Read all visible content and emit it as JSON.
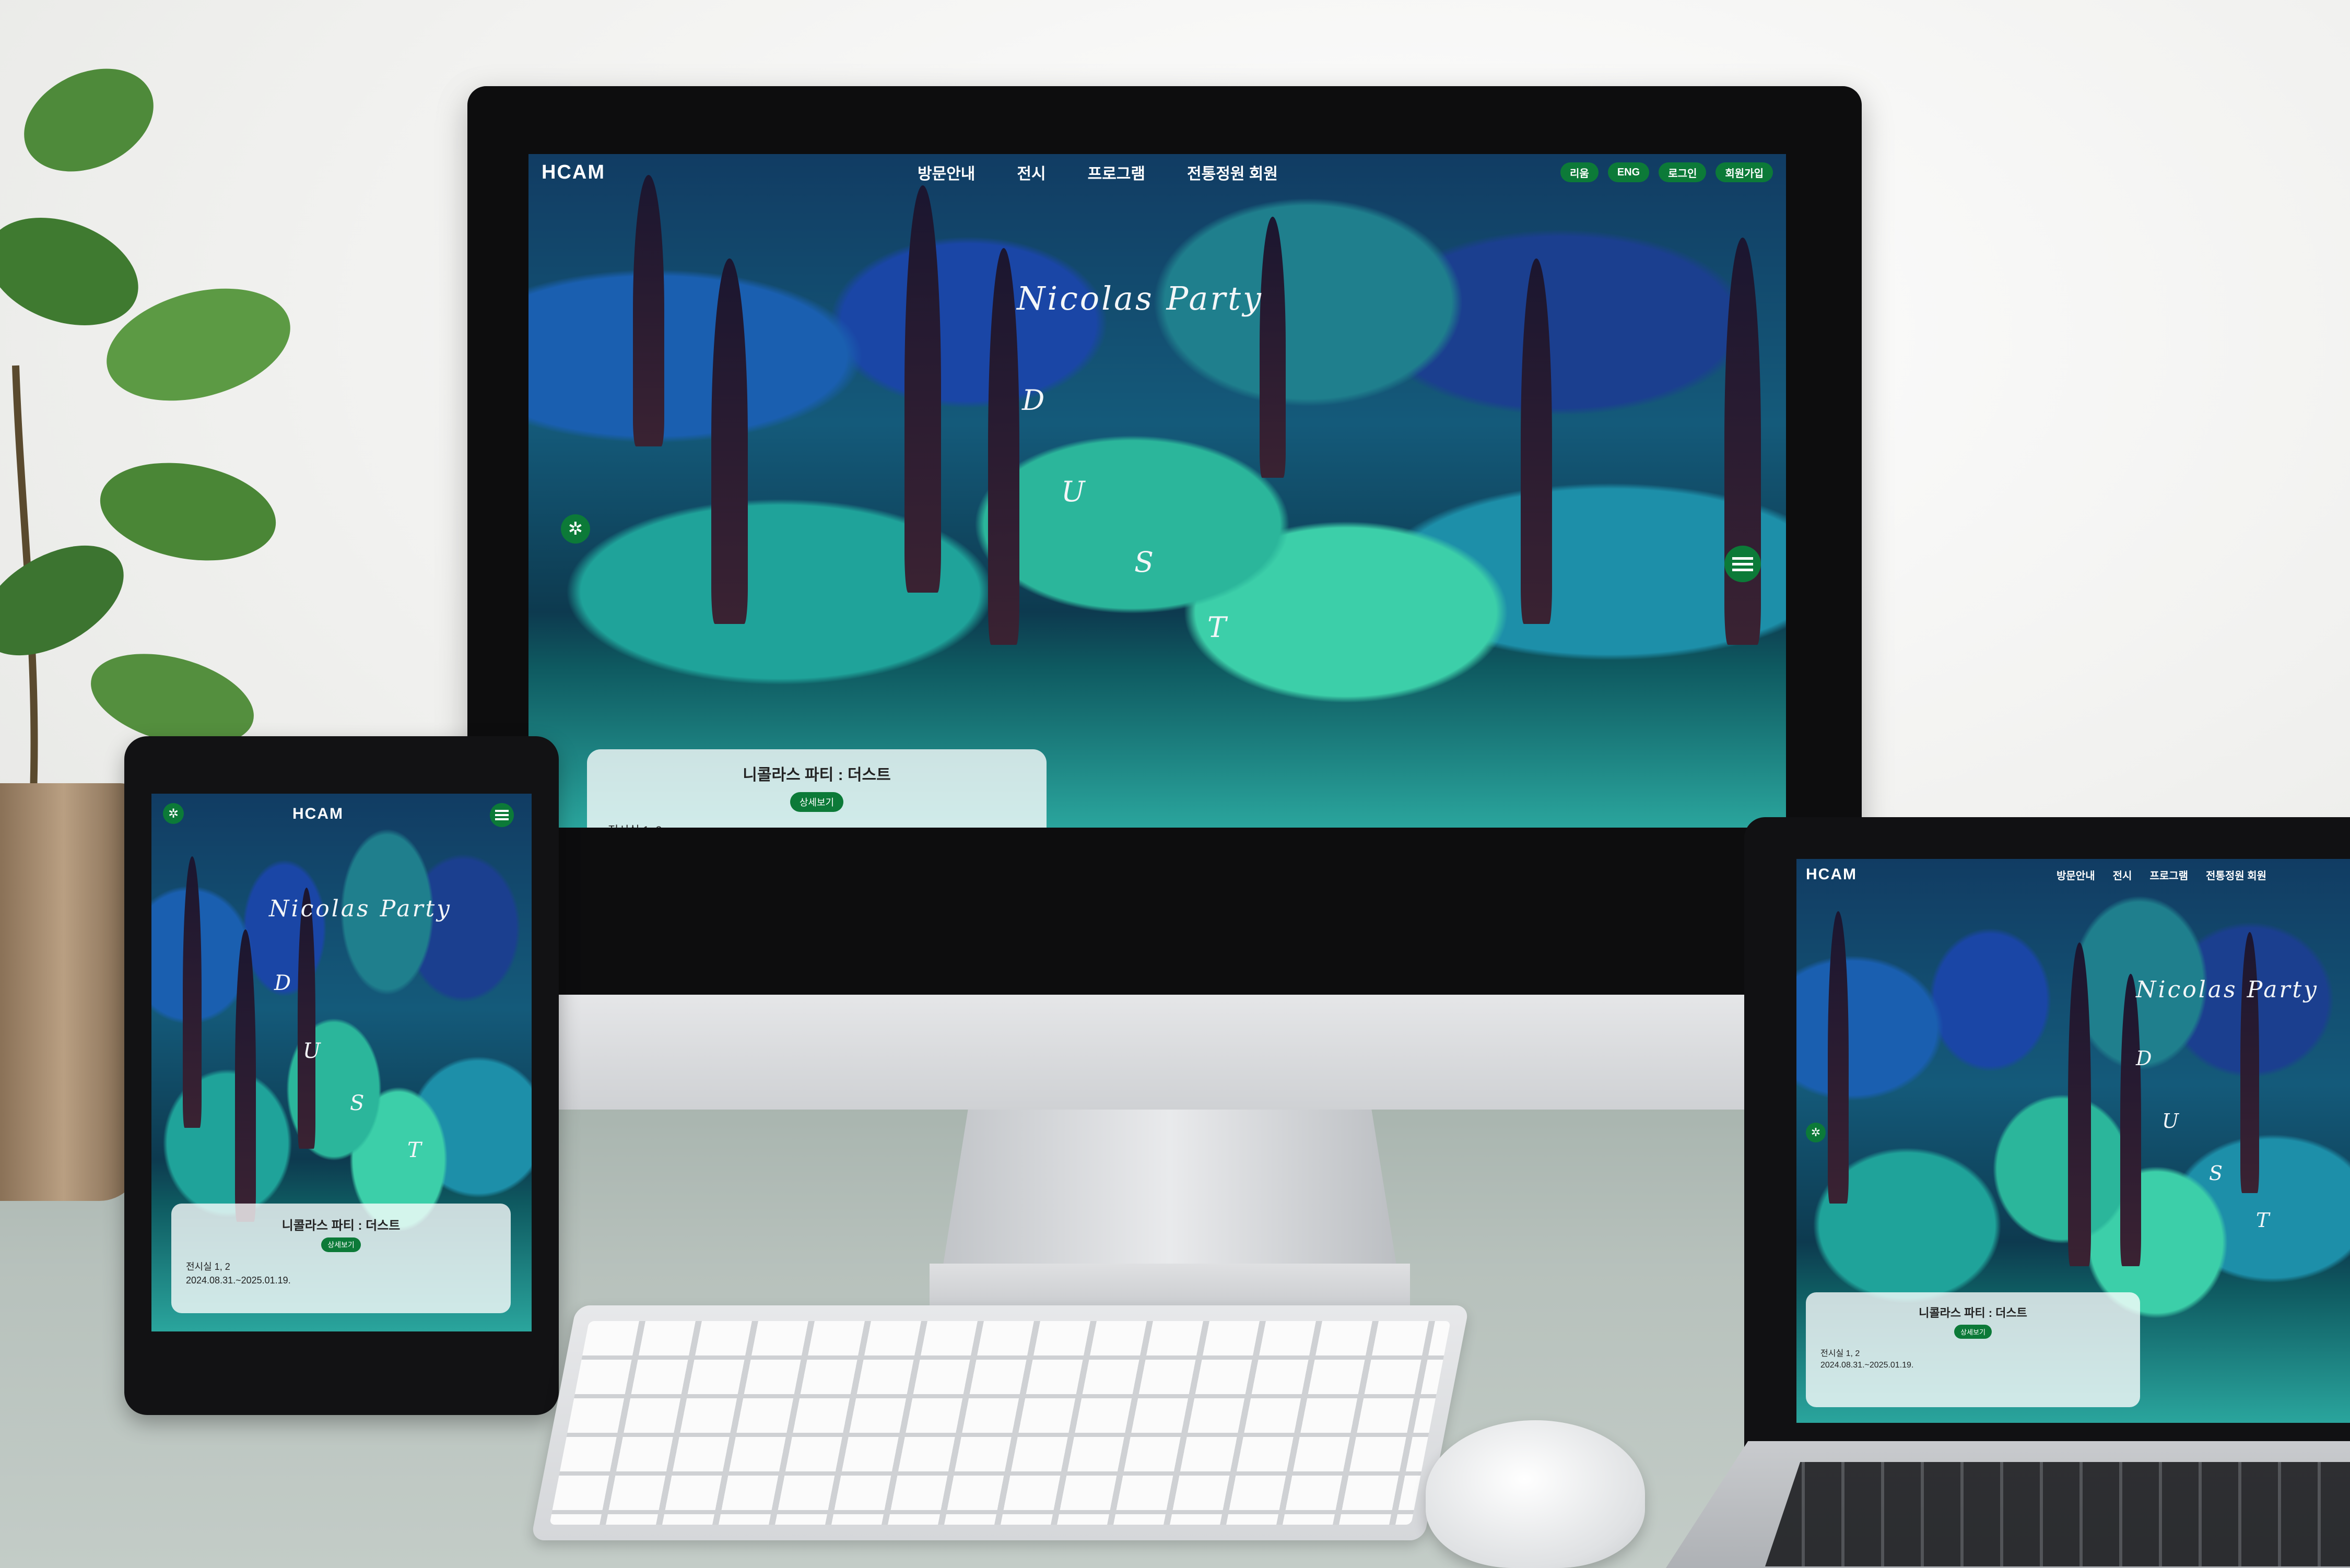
{
  "site": {
    "logo": "HCAM",
    "nav": [
      "방문안내",
      "전시",
      "프로그램",
      "전통정원 회원"
    ],
    "utility": [
      "리움",
      "ENG",
      "로그인",
      "회원가입"
    ],
    "hero": {
      "title": "Nicolas Party",
      "letters": [
        "D",
        "U",
        "S",
        "T"
      ]
    },
    "card": {
      "title": "니콜라스 파티 : 더스트",
      "button": "상세보기",
      "location": "전시실 1, 2",
      "dates": "2024.08.31.~2025.01.19."
    },
    "icons": {
      "settings": "gear-icon",
      "menu": "hamburger-menu-icon",
      "audio": "microphone-icon"
    },
    "accent": "#0c7a38"
  }
}
